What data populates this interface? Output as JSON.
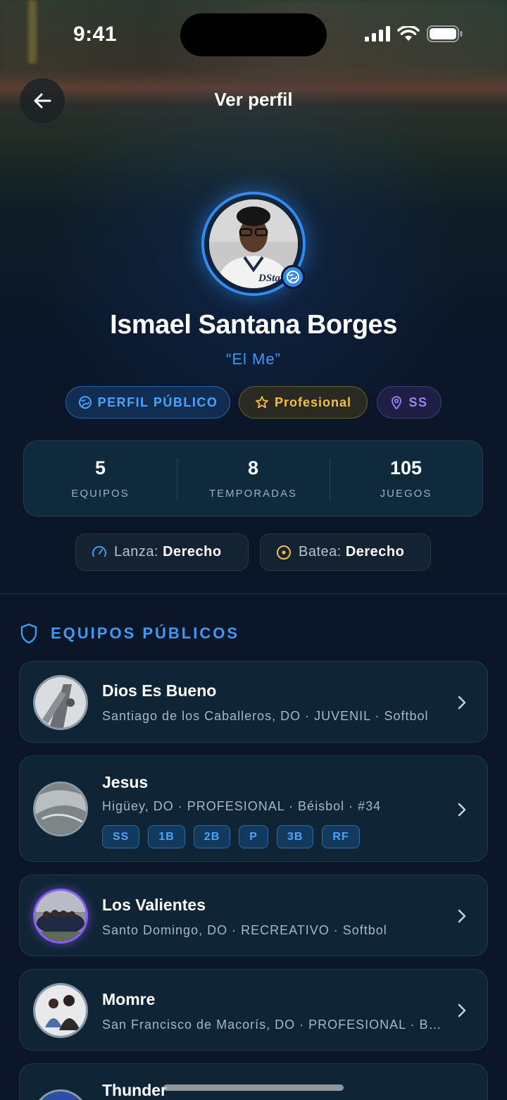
{
  "status_bar": {
    "time": "9:41"
  },
  "header": {
    "title": "Ver perfil"
  },
  "profile": {
    "name": "Ismael Santana Borges",
    "nickname": "“El Me”",
    "pills": {
      "public": "PERFIL PÚBLICO",
      "level": "Profesional",
      "position": "SS"
    },
    "stats": [
      {
        "value": "5",
        "label": "EQUIPOS"
      },
      {
        "value": "8",
        "label": "TEMPORADAS"
      },
      {
        "value": "105",
        "label": "JUEGOS"
      }
    ],
    "throws_label": "Lanza:",
    "throws_value": "Derecho",
    "bats_label": "Batea:",
    "bats_value": "Derecho"
  },
  "teams_section": {
    "title": "EQUIPOS PÚBLICOS",
    "teams": [
      {
        "name": "Dios Es Bueno",
        "subtitle": "Santiago de los Caballeros, DO · JUVENIL · Softbol"
      },
      {
        "name": "Jesus",
        "subtitle": "Higüey, DO · PROFESIONAL · Béisbol · #34",
        "tags": [
          "SS",
          "1B",
          "2B",
          "P",
          "3B",
          "RF"
        ]
      },
      {
        "name": "Los Valientes",
        "subtitle": "Santo Domingo, DO · RECREATIVO · Softbol"
      },
      {
        "name": "Momre",
        "subtitle": "San Francisco de Macorís, DO · PROFESIONAL · Béisbol"
      },
      {
        "name": "Thunder"
      }
    ]
  },
  "colors": {
    "accent": "#3d9bf5",
    "gold": "#f3bf42",
    "purple": "#9a87f5",
    "background": "#0b1728"
  }
}
